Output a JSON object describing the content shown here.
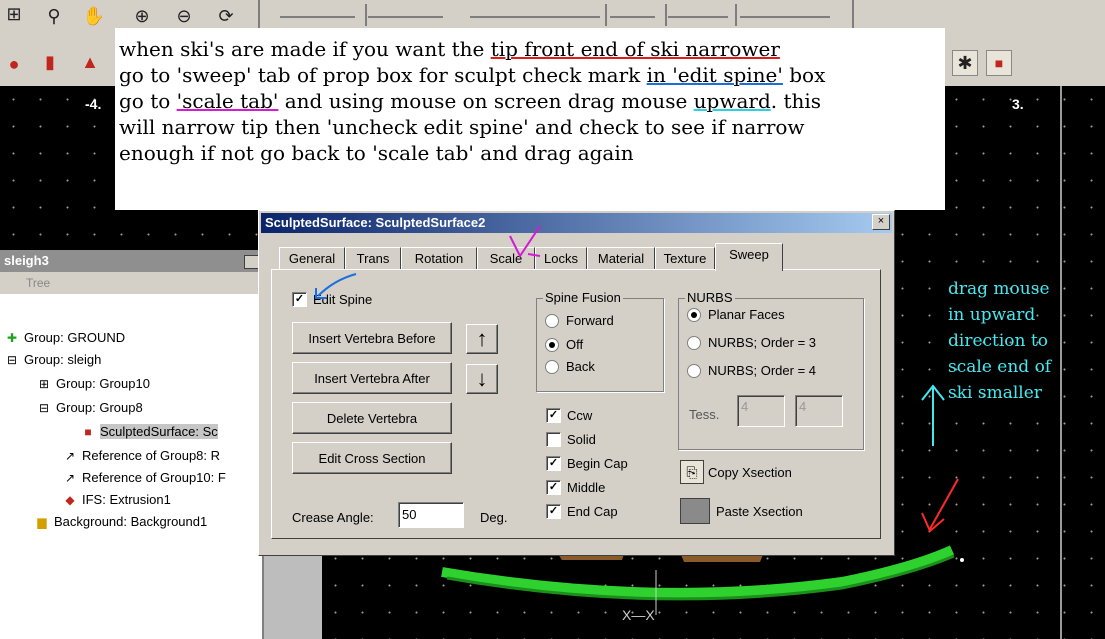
{
  "annotation": {
    "line1_a": "when ski's are made if you want the ",
    "line1_b": "tip front end of ski narrower",
    "line2_a": "go to 'sweep' tab of prop box for sculpt check mark ",
    "line2_b": "in 'edit spine'",
    "line2_c": " box",
    "line3_a": "go to ",
    "line3_b": "'scale tab'",
    "line3_c": " and using mouse on screen drag mouse ",
    "line3_d": "upward",
    "line3_e": ". this",
    "line4": "will narrow tip then 'uncheck edit spine' and check to see if narrow",
    "line5": "enough if not go back to 'scale tab' and drag again"
  },
  "side_note": {
    "line1": "drag mouse",
    "line2": "in upward",
    "line3": "direction to",
    "line4": "scale end of",
    "line5": "ski smaller"
  },
  "viewports": {
    "left_label": "-4.",
    "right_label": "3."
  },
  "tree": {
    "title": "sleigh3",
    "tab_label": "Tree",
    "nodes": [
      {
        "label": "Group: GROUND"
      },
      {
        "label": "Group: sleigh"
      },
      {
        "label": "Group: Group10"
      },
      {
        "label": "Group: Group8"
      },
      {
        "label": "SculptedSurface: Sc"
      },
      {
        "label": "Reference of Group8: R"
      },
      {
        "label": "Reference of Group10: F"
      },
      {
        "label": "IFS: Extrusion1"
      },
      {
        "label": "Background: Background1"
      }
    ]
  },
  "dialog": {
    "title": "SculptedSurface: SculptedSurface2",
    "close": "×",
    "tabs": [
      "General",
      "Trans",
      "Rotation",
      "Scale",
      "Locks",
      "Material",
      "Texture",
      "Sweep"
    ],
    "active_tab": "Sweep",
    "edit_spine": {
      "label": "Edit Spine",
      "checked": true
    },
    "buttons": {
      "insert_before": "Insert Vertebra Before",
      "insert_after": "Insert Vertebra After",
      "delete": "Delete Vertebra",
      "edit_cross": "Edit Cross Section",
      "up_arrow": "↑",
      "down_arrow": "↓"
    },
    "spine_fusion": {
      "legend": "Spine Fusion",
      "options": [
        "Forward",
        "Off",
        "Back"
      ],
      "selected": "Off"
    },
    "checks": [
      {
        "label": "Ccw",
        "checked": true
      },
      {
        "label": "Solid",
        "checked": false
      },
      {
        "label": "Begin Cap",
        "checked": true
      },
      {
        "label": "Middle",
        "checked": true
      },
      {
        "label": "End Cap",
        "checked": true
      }
    ],
    "nurbs": {
      "legend": "NURBS",
      "options": [
        "Planar Faces",
        "NURBS;  Order = 3",
        "NURBS;  Order = 4"
      ],
      "selected": "Planar Faces",
      "tess_label": "Tess.",
      "tess1": "4",
      "tess2": "4"
    },
    "copy_xsection": "Copy Xsection",
    "paste_xsection": "Paste Xsection",
    "crease_label": "Crease Angle:",
    "crease_value": "50",
    "crease_unit": "Deg."
  }
}
